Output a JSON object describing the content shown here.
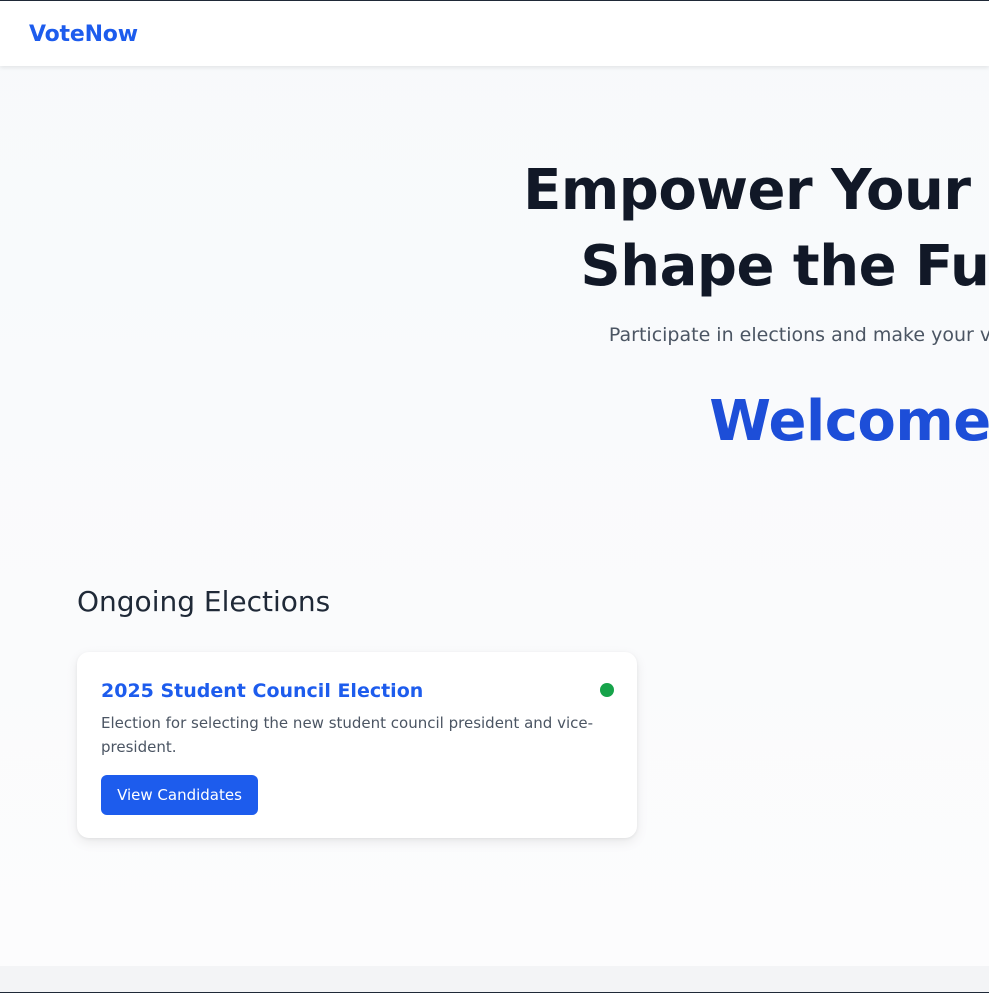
{
  "navbar": {
    "brand": "VoteNow"
  },
  "hero": {
    "title_line1": "Empower Your Voice,",
    "title_line2": "Shape the Future",
    "subtitle": "Participate in elections and make your voice heard",
    "welcome": "Welcome"
  },
  "elections": {
    "section_title": "Ongoing Elections",
    "items": [
      {
        "title": "2025 Student Council Election",
        "description": "Election for selecting the new student council president and vice-president.",
        "button_label": "View Candidates",
        "status_color": "#16a34a"
      }
    ]
  },
  "colors": {
    "brand": "#1d5ced",
    "heading": "#111827",
    "welcome": "#1d4ed8",
    "active_status": "#16a34a"
  }
}
